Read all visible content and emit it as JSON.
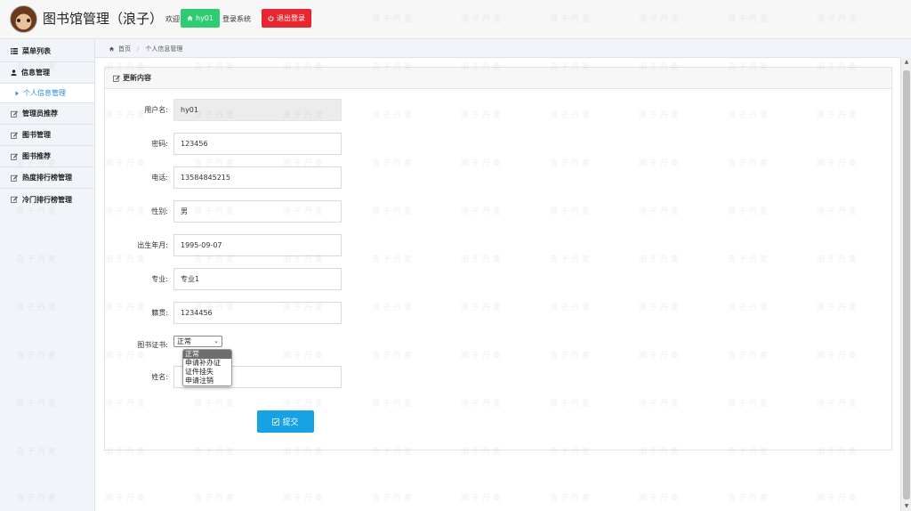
{
  "header": {
    "title": "图书馆管理（浪子）",
    "welcome": "欢迎",
    "username": "hy01",
    "system_text": "登录系统",
    "logout_label": "退出登录"
  },
  "sidebar": {
    "heading": "菜单列表",
    "items": [
      {
        "label": "信息管理",
        "icon": "user-icon"
      },
      {
        "label": "个人信息管理",
        "icon": "caret-right-icon",
        "active": true
      },
      {
        "label": "管理员推荐",
        "icon": "edit-icon"
      },
      {
        "label": "图书管理",
        "icon": "edit-icon"
      },
      {
        "label": "图书推荐",
        "icon": "edit-icon"
      },
      {
        "label": "热度排行榜管理",
        "icon": "edit-icon"
      },
      {
        "label": "冷门排行榜管理",
        "icon": "edit-icon"
      }
    ]
  },
  "breadcrumb": {
    "home": "首页",
    "current": "个人信息管理"
  },
  "panel": {
    "title": "更新内容"
  },
  "form": {
    "username_label": "用户名:",
    "username_value": "hy01",
    "password_label": "密码:",
    "password_value": "123456",
    "phone_label": "电话:",
    "phone_value": "13584845215",
    "gender_label": "性别:",
    "gender_value": "男",
    "birth_label": "出生年月:",
    "birth_value": "1995-09-07",
    "major_label": "专业:",
    "major_value": "专业1",
    "origin_label": "籍贯:",
    "origin_value": "1234456",
    "card_label": "图书证书:",
    "card_value": "正常",
    "card_options": [
      "正常",
      "申请补办证",
      "证件挂失",
      "申请注销"
    ],
    "name_label": "姓名:",
    "name_value": "",
    "submit_label": "提交"
  },
  "watermark": "浪子丹麦",
  "colors": {
    "user_button": "#2ecc71",
    "logout_button": "#e8262f",
    "submit_button": "#17a2e6",
    "active_link": "#2b8cd6"
  }
}
